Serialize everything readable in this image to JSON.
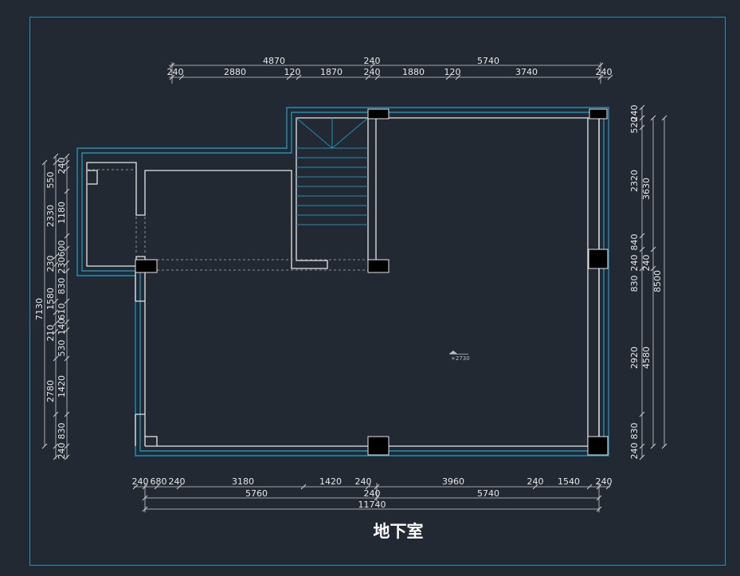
{
  "title": "地下室",
  "elevation": "+2730",
  "dims": {
    "top_row1": [
      "4870",
      "240",
      "5740"
    ],
    "top_row2": [
      "240",
      "2880",
      "120",
      "1870",
      "240",
      "1880",
      "120",
      "3740",
      "240"
    ],
    "bottom_row1": [
      "240",
      "680",
      "240",
      "3180",
      "1420",
      "240",
      "3960",
      "240",
      "1540",
      "240"
    ],
    "bottom_row2": [
      "5760",
      "240",
      "5740"
    ],
    "bottom_total": "11740",
    "left_inner": [
      "550",
      "240",
      "1180",
      "2330",
      "230",
      "600",
      "230",
      "1580",
      "830",
      "140",
      "610",
      "210",
      "530",
      "1420",
      "2780",
      "830",
      "240"
    ],
    "left_total": "7130",
    "right_inner": [
      "240",
      "520",
      "2320",
      "840",
      "240",
      "830",
      "2920",
      "830",
      "240"
    ],
    "right_mid": [
      "3630",
      "240",
      "4580"
    ],
    "right_total": "8500"
  }
}
